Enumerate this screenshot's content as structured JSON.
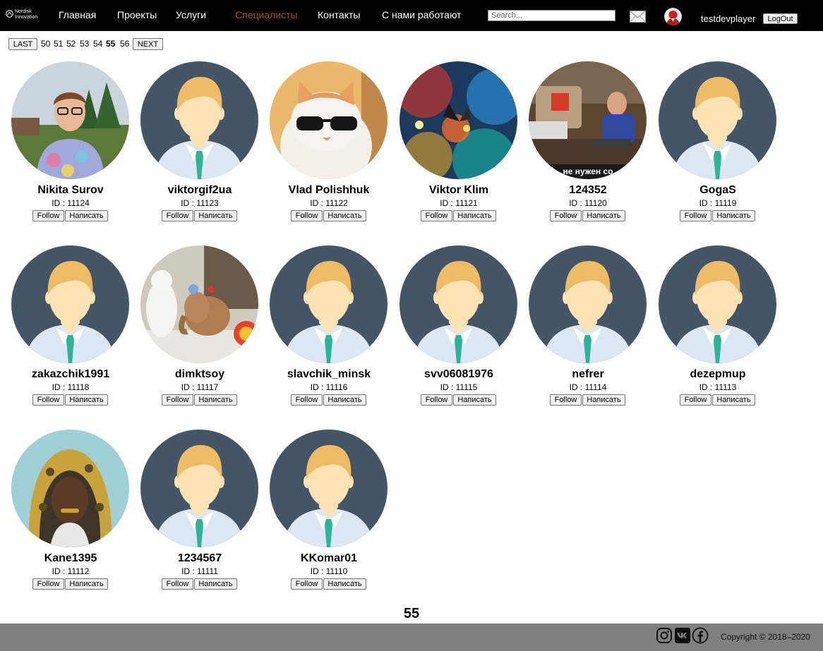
{
  "header": {
    "logo_line1": "Nordisk",
    "logo_line2": "Innovation",
    "nav": [
      "Главная",
      "Проекты",
      "Услуги",
      "Специалисты",
      "Контакты",
      "С нами работают"
    ],
    "active_nav": "Специалисты",
    "search_placeholder": "Search...",
    "username": "testdevplayer",
    "logout_label": "LogOut",
    "mail_icon": "envelope-icon",
    "avatar_icon": "user-avatar-icon"
  },
  "pager": {
    "last_label": "LAST",
    "pages": [
      "50",
      "51",
      "52",
      "53",
      "54",
      "55",
      "56"
    ],
    "current": "55",
    "next_label": "NEXT"
  },
  "users": [
    {
      "name": "Nikita Surov",
      "id": "ID : 11124",
      "avatar": "photo-person-glasses"
    },
    {
      "name": "viktorgif2ua",
      "id": "ID : 11123",
      "avatar": "default"
    },
    {
      "name": "Vlad Polishhuk",
      "id": "ID : 11122",
      "avatar": "photo-cat-sunglasses"
    },
    {
      "name": "Viktor Klim",
      "id": "ID : 11121",
      "avatar": "photo-colorful-butterfly"
    },
    {
      "name": "124352",
      "id": "ID : 11120",
      "avatar": "photo-tv-scene"
    },
    {
      "name": "GogaS",
      "id": "ID : 11119",
      "avatar": "default"
    },
    {
      "name": "zakazchik1991",
      "id": "ID : 11118",
      "avatar": "default"
    },
    {
      "name": "dimktsoy",
      "id": "ID : 11117",
      "avatar": "photo-toys"
    },
    {
      "name": "slavchik_minsk",
      "id": "ID : 11116",
      "avatar": "default"
    },
    {
      "name": "svv06081976",
      "id": "ID : 11115",
      "avatar": "default"
    },
    {
      "name": "nefrer",
      "id": "ID : 11114",
      "avatar": "default"
    },
    {
      "name": "dezepmup",
      "id": "ID : 11113",
      "avatar": "default"
    },
    {
      "name": "Kane1395",
      "id": "ID : 11112",
      "avatar": "photo-person-hood"
    },
    {
      "name": "1234567",
      "id": "ID : 11111",
      "avatar": "default"
    },
    {
      "name": "KKomar01",
      "id": "ID : 11110",
      "avatar": "default"
    }
  ],
  "follow_label": "Follow",
  "write_label": "Написать",
  "tv_caption": "не нужен со",
  "current_page_big": "55",
  "footer": {
    "icons": [
      "instagram-icon",
      "vk-icon",
      "facebook-icon"
    ],
    "copyright": "Copyright © 2018–2020"
  },
  "colors": {
    "header_bg": "#000000",
    "active_nav": "#a0522d",
    "footer_bg": "#808080",
    "avatar_bg": "#445566",
    "skin": "#fce3b4",
    "hair": "#eebb66",
    "shirt": "#dde7f1",
    "tie": "#2bb594"
  }
}
